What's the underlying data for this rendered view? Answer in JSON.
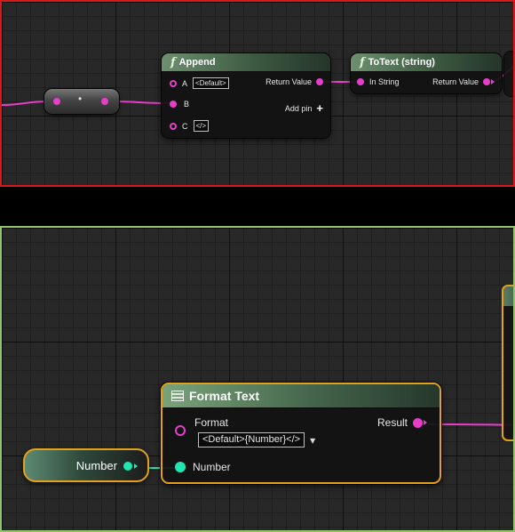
{
  "top_graph": {
    "reroute": {
      "label": "•"
    },
    "append_node": {
      "title": "Append",
      "function_glyph": "f",
      "pins": {
        "a_label": "A",
        "a_value": "<Default>",
        "b_label": "B",
        "c_label": "C",
        "c_value": "</>",
        "return_label": "Return Value",
        "add_pin_label": "Add pin",
        "add_pin_icon": "+"
      }
    },
    "totext_node": {
      "title": "ToText (string)",
      "function_glyph": "f",
      "pins": {
        "in_label": "In String",
        "return_label": "Return Value"
      }
    }
  },
  "bottom_graph": {
    "number_node": {
      "label": "Number"
    },
    "format_node": {
      "title": "Format Text",
      "format_label": "Format",
      "format_value": "<Default>{Number}</>",
      "dropdown_icon": "▾",
      "result_label": "Result",
      "number_label": "Number"
    }
  },
  "colors": {
    "string_pin": "#e63ec8",
    "number_pin": "#1ee7b1",
    "top_border": "#d8191c",
    "bottom_border": "#8fc46a",
    "selection": "#e3a21a"
  }
}
